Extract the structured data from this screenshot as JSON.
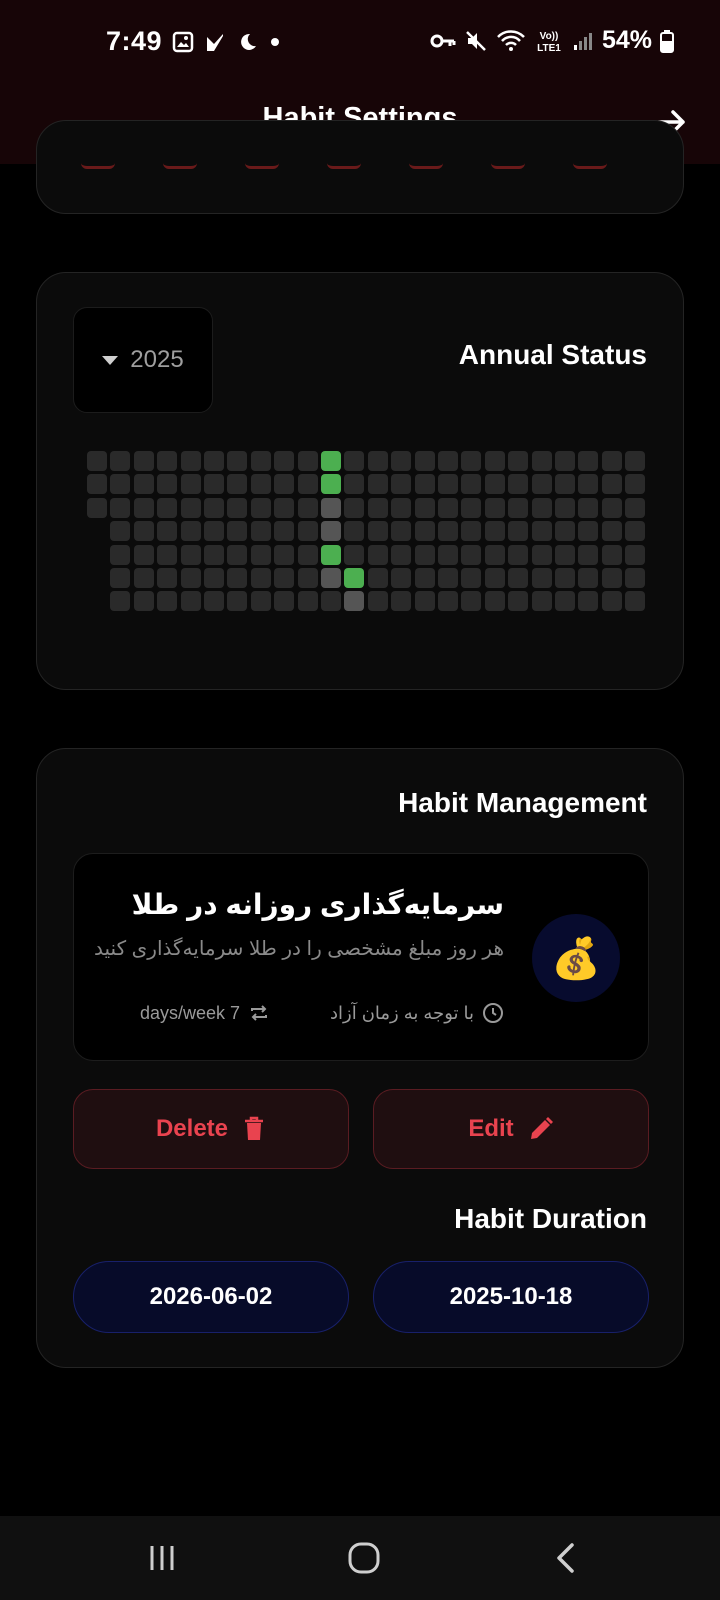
{
  "status_bar": {
    "time": "7:49",
    "battery": "54%",
    "network": "LTE1",
    "left_icons": [
      "gallery-icon",
      "navigation-arrow-icon",
      "moon-icon",
      "dot-icon"
    ],
    "right_icons": [
      "key-icon",
      "mute-icon",
      "wifi-icon",
      "volte-icon",
      "signal-icon",
      "battery-icon"
    ]
  },
  "app_bar": {
    "title": "Habit Settings",
    "action_icon": "arrow-right-icon"
  },
  "annual_status": {
    "title": "Annual Status",
    "year": "2025",
    "colors": {
      "empty": "#2a2a2a",
      "done": "#4caf50",
      "today": "#555555"
    },
    "weeks": 24,
    "first_week_start_row": 0,
    "completed_cells": [
      [
        10,
        0
      ],
      [
        10,
        1
      ],
      [
        10,
        4
      ],
      [
        11,
        5
      ]
    ],
    "highlighted_cells": [
      [
        10,
        2
      ],
      [
        10,
        3
      ],
      [
        10,
        5
      ],
      [
        11,
        6
      ]
    ]
  },
  "habit_management": {
    "title": "Habit Management",
    "habit": {
      "icon": "money-bag-icon",
      "name": "سرمایه‌گذاری روزانه در طلا",
      "description": "هر روز مبلغ مشخصی را در طلا سرمایه‌گذاری کنید",
      "time_label": "با توجه به زمان آزاد",
      "frequency_label": "days/week 7"
    },
    "delete_label": "Delete",
    "edit_label": "Edit",
    "accent": "#e9434f"
  },
  "habit_duration": {
    "title": "Habit Duration",
    "end_date": "2026-06-02",
    "start_date": "2025-10-18"
  },
  "nav_bar": {
    "items": [
      "recents-icon",
      "home-icon",
      "back-icon"
    ]
  }
}
